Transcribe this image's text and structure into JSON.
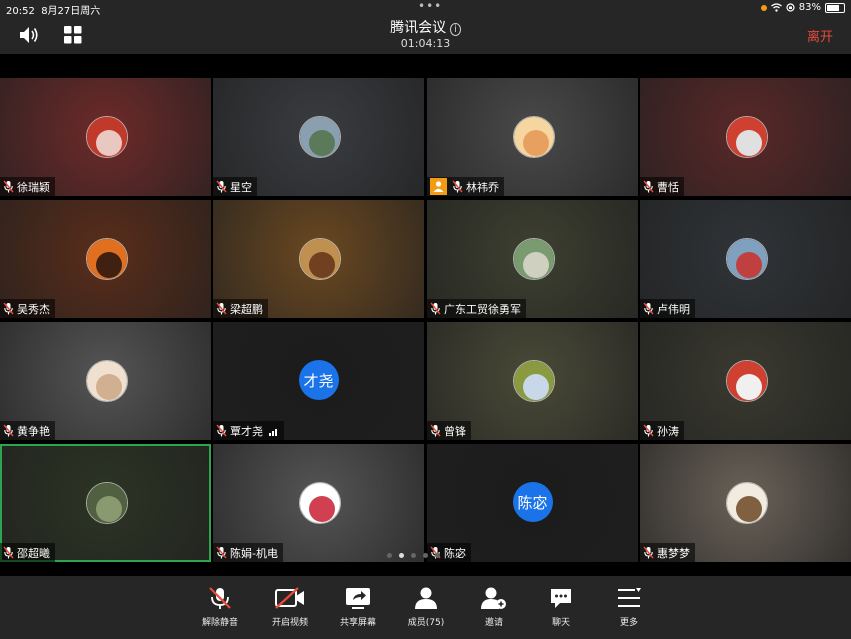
{
  "status": {
    "time": "20:52",
    "date": "8月27日周六",
    "battery": "83%",
    "battery_level": 0.83
  },
  "header": {
    "title": "腾讯会议",
    "info_glyph": "i",
    "timer": "01:04:13",
    "leave_label": "离开"
  },
  "participants": [
    {
      "name": "徐瑞颖",
      "bg": "#6e2a2a",
      "avatar": "flag"
    },
    {
      "name": "星空",
      "bg": "#3a3c40",
      "avatar": "photo"
    },
    {
      "name": "林祎乔",
      "bg": "#4a4a4a",
      "avatar": "photo",
      "sharing": true
    },
    {
      "name": "曹恬",
      "bg": "#5a2828",
      "avatar": "photo"
    },
    {
      "name": "吴秀杰",
      "bg": "#5a2d1a",
      "avatar": "photo"
    },
    {
      "name": "梁超鹏",
      "bg": "#6a4820",
      "avatar": "photo"
    },
    {
      "name": "广东工贸徐勇军",
      "bg": "#3d4030",
      "avatar": "photo"
    },
    {
      "name": "卢伟明",
      "bg": "#303438",
      "avatar": "photo"
    },
    {
      "name": "黄争艳",
      "bg": "#555555",
      "avatar": "photo"
    },
    {
      "name": "覃才尧",
      "bg": "#1c1c1c",
      "avatar_text": "才尧",
      "signal": true
    },
    {
      "name": "曾锋",
      "bg": "#4a4a38",
      "avatar": "photo"
    },
    {
      "name": "孙涛",
      "bg": "#3a3a30",
      "avatar": "photo"
    },
    {
      "name": "邵超曦",
      "bg": "#2c3424",
      "avatar": "photo",
      "active": true
    },
    {
      "name": "陈娟-机电",
      "bg": "#555",
      "avatar": "photo"
    },
    {
      "name": "陈宓",
      "bg": "#1c1c1c",
      "avatar_text": "陈宓"
    },
    {
      "name": "惠梦梦",
      "bg": "#6a6258",
      "avatar": "photo"
    }
  ],
  "pager": {
    "pages": 5,
    "current": 2
  },
  "toolbar": [
    {
      "label": "解除静音",
      "icon": "mic-muted-icon"
    },
    {
      "label": "开启视频",
      "icon": "video-off-icon"
    },
    {
      "label": "共享屏幕",
      "icon": "share-screen-icon"
    },
    {
      "label": "成员(75)",
      "icon": "members-icon"
    },
    {
      "label": "邀请",
      "icon": "invite-icon"
    },
    {
      "label": "聊天",
      "icon": "chat-icon"
    },
    {
      "label": "更多",
      "icon": "more-icon"
    }
  ],
  "colors": {
    "accent_blue": "#1a73e8",
    "leave_red": "#e64b3b",
    "active_green": "#2ea44f",
    "share_orange": "#f39c12"
  }
}
